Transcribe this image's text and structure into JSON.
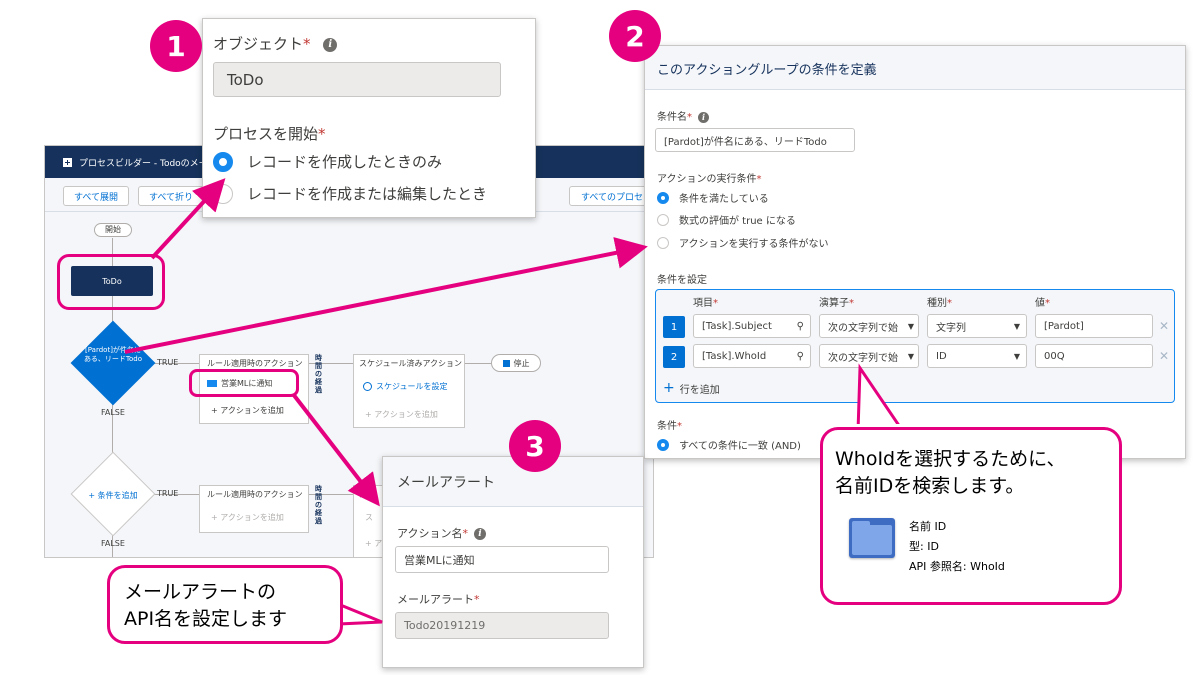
{
  "badges": [
    "1",
    "2",
    "3"
  ],
  "builder": {
    "title": "プロセスビルダー - Todoのメー",
    "buttons": {
      "expand": "すべて展開",
      "collapse": "すべて折り",
      "all_process": "すべてのプロセ"
    },
    "nodes": {
      "start": "開始",
      "object": "ToDo",
      "criteria": "[Pardot]が件名にある、リードTodo",
      "true1": "TRUE",
      "false1": "FALSE",
      "true2": "TRUE",
      "false2": "FALSE",
      "immediate1": "ルール適用時のアクション",
      "action1": "営業MLに通知",
      "add_action1": "+ アクションを追加",
      "time1": "時間の経過",
      "scheduled": "スケジュール済みアクション",
      "schedule_set": "スケジュールを設定",
      "add_action_sched": "+ アクションを追加",
      "stop": "停止",
      "add_criteria": "+ 条件を追加",
      "immediate2": "ルール適用時のアクション",
      "add_action2": "+ アクションを追加",
      "time2": "時間の経過",
      "sched2_a": "ス",
      "sched2_b": "ス",
      "sched2_c": "+ ア"
    }
  },
  "panel1": {
    "object_label": "オブジェクト",
    "object_value": "ToDo",
    "start_label": "プロセスを開始",
    "options": [
      "レコードを作成したときのみ",
      "レコードを作成または編集したとき"
    ]
  },
  "panel2": {
    "title": "このアクショングループの条件を定義",
    "name_label": "条件名",
    "name_value": "[Pardot]が件名にある、リードTodo",
    "exec_label": "アクションの実行条件",
    "exec_options": [
      "条件を満たしている",
      "数式の評価が true になる",
      "アクションを実行する条件がない"
    ],
    "set_label": "条件を設定",
    "col_headers": [
      "項目",
      "演算子",
      "種別",
      "値"
    ],
    "rows": [
      {
        "num": "1",
        "field": "[Task].Subject",
        "op": "次の文字列で始",
        "type": "文字列",
        "value": "[Pardot]"
      },
      {
        "num": "2",
        "field": "[Task].WhoId",
        "op": "次の文字列で始",
        "type": "ID",
        "value": "00Q"
      }
    ],
    "add_row": "行を追加",
    "cond_label": "条件",
    "cond_option": "すべての条件に一致 (AND)"
  },
  "panel3": {
    "title": "メールアラート",
    "action_label": "アクション名",
    "action_value": "営業MLに通知",
    "alert_label": "メールアラート",
    "alert_value": "Todo20191219"
  },
  "callout_api": {
    "line1": "メールアラートの",
    "line2": "API名を設定します"
  },
  "callout_whoid": {
    "line1": "WhoIdを選択するために、",
    "line2": "名前IDを検索します。",
    "info_lines": [
      "名前 ID",
      "型: ID",
      "API 参照名: WhoId"
    ]
  },
  "colors": {
    "accent": "#e5007f",
    "brand": "#16325c",
    "blue": "#0070d2"
  }
}
